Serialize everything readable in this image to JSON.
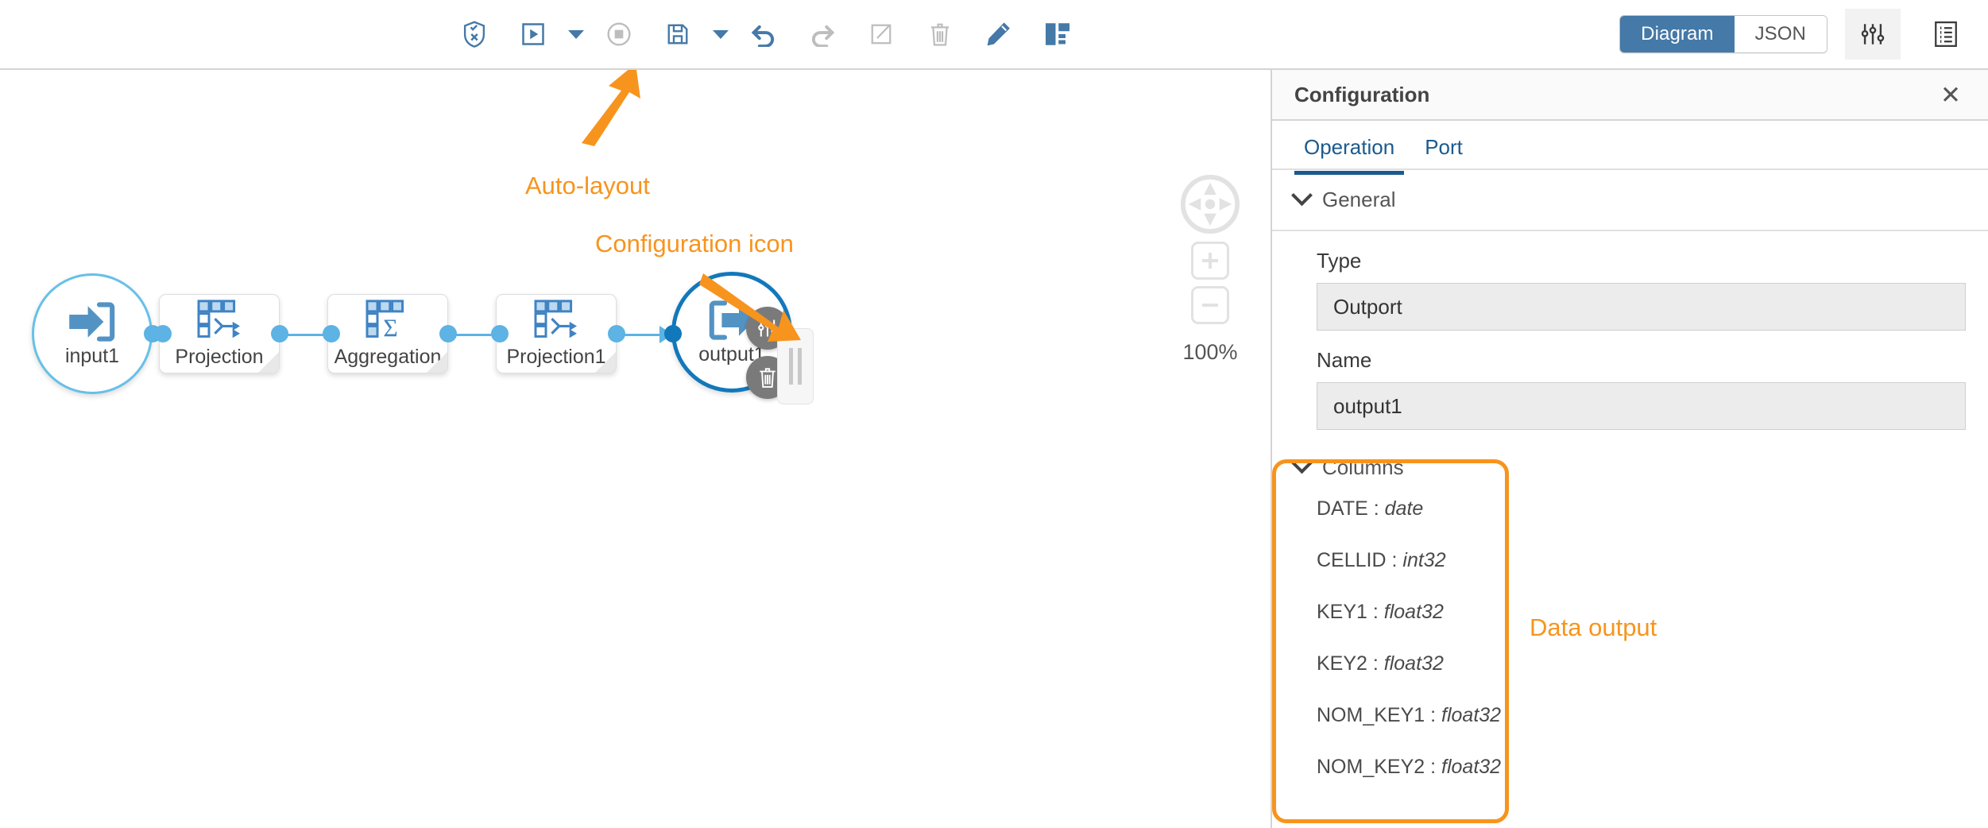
{
  "toolbar": {
    "center_buttons": [
      {
        "name": "validate-icon",
        "title": "Validate"
      },
      {
        "name": "run-icon",
        "title": "Run"
      },
      {
        "name": "run-dropdown-caret-icon",
        "title": "Run options"
      },
      {
        "name": "stop-icon",
        "title": "Stop"
      },
      {
        "name": "save-icon",
        "title": "Save"
      },
      {
        "name": "save-dropdown-caret-icon",
        "title": "Save options"
      },
      {
        "name": "undo-icon",
        "title": "Undo"
      },
      {
        "name": "redo-icon",
        "title": "Redo"
      },
      {
        "name": "open-editor-icon",
        "title": "Open editor"
      },
      {
        "name": "delete-icon",
        "title": "Delete"
      },
      {
        "name": "edit-icon",
        "title": "Edit"
      },
      {
        "name": "auto-layout-icon",
        "title": "Auto-layout"
      }
    ],
    "view_toggle": {
      "options": [
        "Diagram",
        "JSON"
      ],
      "selected": "Diagram"
    },
    "right_buttons": [
      {
        "name": "configuration-panel-icon",
        "title": "Configuration",
        "active": true
      },
      {
        "name": "log-list-icon",
        "title": "Log",
        "active": false
      }
    ]
  },
  "canvas": {
    "zoom": {
      "level_label": "100%",
      "pan_control": "pan-compass-icon",
      "zoom_in": "+",
      "zoom_out": "−"
    },
    "nodes": [
      {
        "id": "input1",
        "label": "input1",
        "type": "circle-input",
        "icon": "data-input-icon"
      },
      {
        "id": "projection",
        "label": "Projection",
        "type": "box",
        "icon": "projection-icon"
      },
      {
        "id": "aggregation",
        "label": "Aggregation",
        "type": "box",
        "icon": "aggregation-icon"
      },
      {
        "id": "projection1",
        "label": "Projection1",
        "type": "box",
        "icon": "projection-icon"
      },
      {
        "id": "output1",
        "label": "output1",
        "type": "circle-output",
        "icon": "data-output-icon",
        "selected": true
      }
    ],
    "node_actions": [
      {
        "name": "node-configuration-button",
        "icon": "sliders-icon"
      },
      {
        "name": "node-delete-button",
        "icon": "trash-icon"
      }
    ]
  },
  "annotations": [
    {
      "id": "auto-layout",
      "text": "Auto-layout",
      "color": "#f7941e"
    },
    {
      "id": "configuration-icon",
      "text": "Configuration icon",
      "color": "#f7941e"
    },
    {
      "id": "data-output",
      "text": "Data output",
      "color": "#f7941e"
    }
  ],
  "panel": {
    "title": "Configuration",
    "close_label": "✕",
    "tabs": [
      {
        "label": "Operation",
        "active": true
      },
      {
        "label": "Port",
        "active": false
      }
    ],
    "general": {
      "section_label": "General",
      "type_label": "Type",
      "type_value": "Outport",
      "name_label": "Name",
      "name_value": "output1"
    },
    "columns": {
      "section_label": "Columns",
      "items": [
        {
          "name": "DATE",
          "type": "date"
        },
        {
          "name": "CELLID",
          "type": "int32"
        },
        {
          "name": "KEY1",
          "type": "float32"
        },
        {
          "name": "KEY2",
          "type": "float32"
        },
        {
          "name": "NOM_KEY1",
          "type": "float32"
        },
        {
          "name": "NOM_KEY2",
          "type": "float32"
        }
      ]
    }
  },
  "colors": {
    "accent_blue": "#4479a8",
    "node_blue": "#5393c4",
    "edge_blue": "#5cb3e4",
    "annotation_orange": "#f7941e",
    "selected_ring": "#1278bc"
  }
}
